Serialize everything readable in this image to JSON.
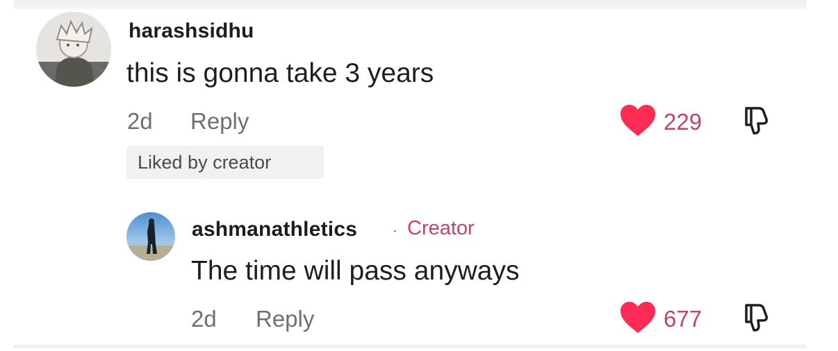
{
  "comments": [
    {
      "username": "harashsidhu",
      "text": "this is gonna take 3 years",
      "time": "2d",
      "reply_label": "Reply",
      "badge": "Liked by creator",
      "likes": "229",
      "liked": true
    }
  ],
  "reply": {
    "username": "ashmanathletics",
    "separator": "·",
    "creator_label": "Creator",
    "text": "The time will pass anyways",
    "time": "2d",
    "reply_label": "Reply",
    "likes": "677",
    "liked": true
  },
  "colors": {
    "heart": "#fe2c55",
    "like_count": "#c24468",
    "creator_label": "#c24468"
  },
  "icons": {
    "like": "heart-icon",
    "dislike": "thumbs-down-icon"
  }
}
